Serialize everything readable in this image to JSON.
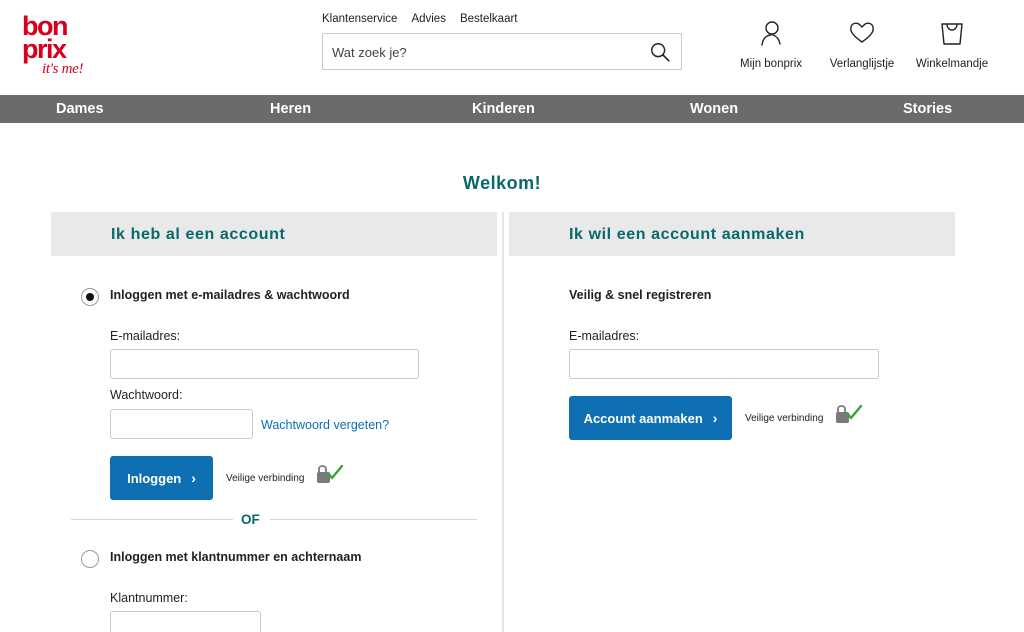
{
  "logo": {
    "line1": "bon",
    "line2": "prix",
    "tagline": "it's me!"
  },
  "toplinks": [
    "Klantenservice",
    "Advies",
    "Bestelkaart"
  ],
  "search": {
    "placeholder": "Wat zoek je?",
    "icon": "search-icon"
  },
  "header_icons": {
    "account": {
      "label": "Mijn bonprix",
      "icon": "user-icon"
    },
    "wishlist": {
      "label": "Verlanglijstje",
      "icon": "heart-icon"
    },
    "cart": {
      "label": "Winkelmandje",
      "icon": "shopping-bag-icon"
    }
  },
  "nav": [
    "Dames",
    "Heren",
    "Kinderen",
    "Wonen",
    "Stories"
  ],
  "title": "Welkom!",
  "login": {
    "heading": "Ik heb al een account",
    "option_email": "Inloggen met e-mailadres & wachtwoord",
    "email_label": "E-mailadres:",
    "email_value": "",
    "password_label": "Wachtwoord:",
    "password_value": "",
    "forgot_link": "Wachtwoord vergeten?",
    "button": "Inloggen",
    "secure": "Veilige verbinding",
    "or": "OF",
    "option_customer": "Inloggen met klantnummer en achternaam",
    "customer_label": "Klantnummer:",
    "customer_value": ""
  },
  "register": {
    "heading": "Ik wil een account aanmaken",
    "subtitle": "Veilig & snel registreren",
    "email_label": "E-mailadres:",
    "email_value": "",
    "button": "Account aanmaken",
    "secure": "Veilige verbinding"
  },
  "colors": {
    "brand": "#d6001c",
    "accent": "#08696a",
    "button": "#0e6fb3",
    "nav": "#6b6b6b",
    "link": "#0a6fb5"
  }
}
